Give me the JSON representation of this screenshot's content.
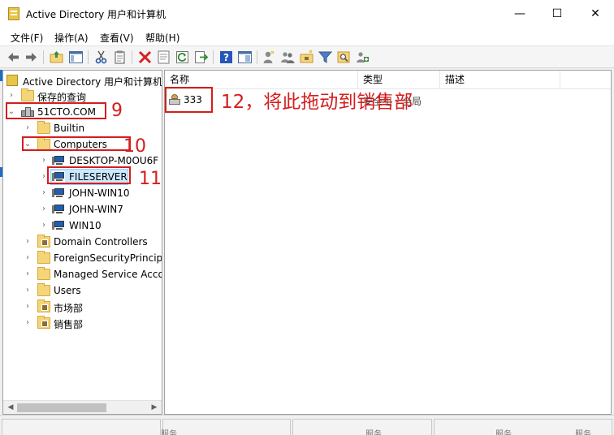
{
  "window": {
    "title": "Active Directory 用户和计算机",
    "controls": {
      "minimize": "—",
      "maximize": "☐",
      "close": "✕"
    }
  },
  "menu": [
    "文件(F)",
    "操作(A)",
    "查看(V)",
    "帮助(H)"
  ],
  "toolbar_icons": [
    "back-arrow-icon",
    "forward-arrow-icon",
    "up-folder-icon",
    "show-hide-tree-icon",
    "cut-icon",
    "copy-icon",
    "delete-icon",
    "properties-icon",
    "refresh-icon",
    "export-list-icon",
    "help-icon",
    "mmc-console-icon",
    "new-user-icon",
    "new-group-icon",
    "new-ou-icon",
    "filter-icon",
    "find-icon",
    "add-to-group-icon"
  ],
  "tree": {
    "root": "Active Directory 用户和计算机",
    "saved_queries": "保存的查询",
    "domain": "51CTO.COM",
    "builtin": "Builtin",
    "computers": "Computers",
    "computer_items": [
      "DESKTOP-M0OU6F",
      "FILESERVER",
      "JOHN-WIN10",
      "JOHN-WIN7",
      "WIN10"
    ],
    "selected": "FILESERVER",
    "domain_controllers": "Domain Controllers",
    "foreign_security": "ForeignSecurityPrincipa",
    "managed_service": "Managed Service Acco",
    "users": "Users",
    "market_dept": "市场部",
    "sales_dept": "销售部"
  },
  "list": {
    "columns": [
      "名称",
      "类型",
      "描述"
    ],
    "rows": [
      {
        "name": "333",
        "type": "安全组 - 全局",
        "description": ""
      }
    ]
  },
  "annotations": {
    "n9": "9",
    "n10": "10",
    "n11": "11",
    "n12": "12，将此拖动到销售部"
  },
  "status": {
    "cells": [
      "",
      "",
      "",
      ""
    ],
    "cut_labels": [
      "服务",
      "服务",
      "服务",
      "服务"
    ]
  },
  "colors": {
    "annotation": "#d51d1d",
    "selection": "#cce8ff",
    "folder": "#f4d57a"
  }
}
